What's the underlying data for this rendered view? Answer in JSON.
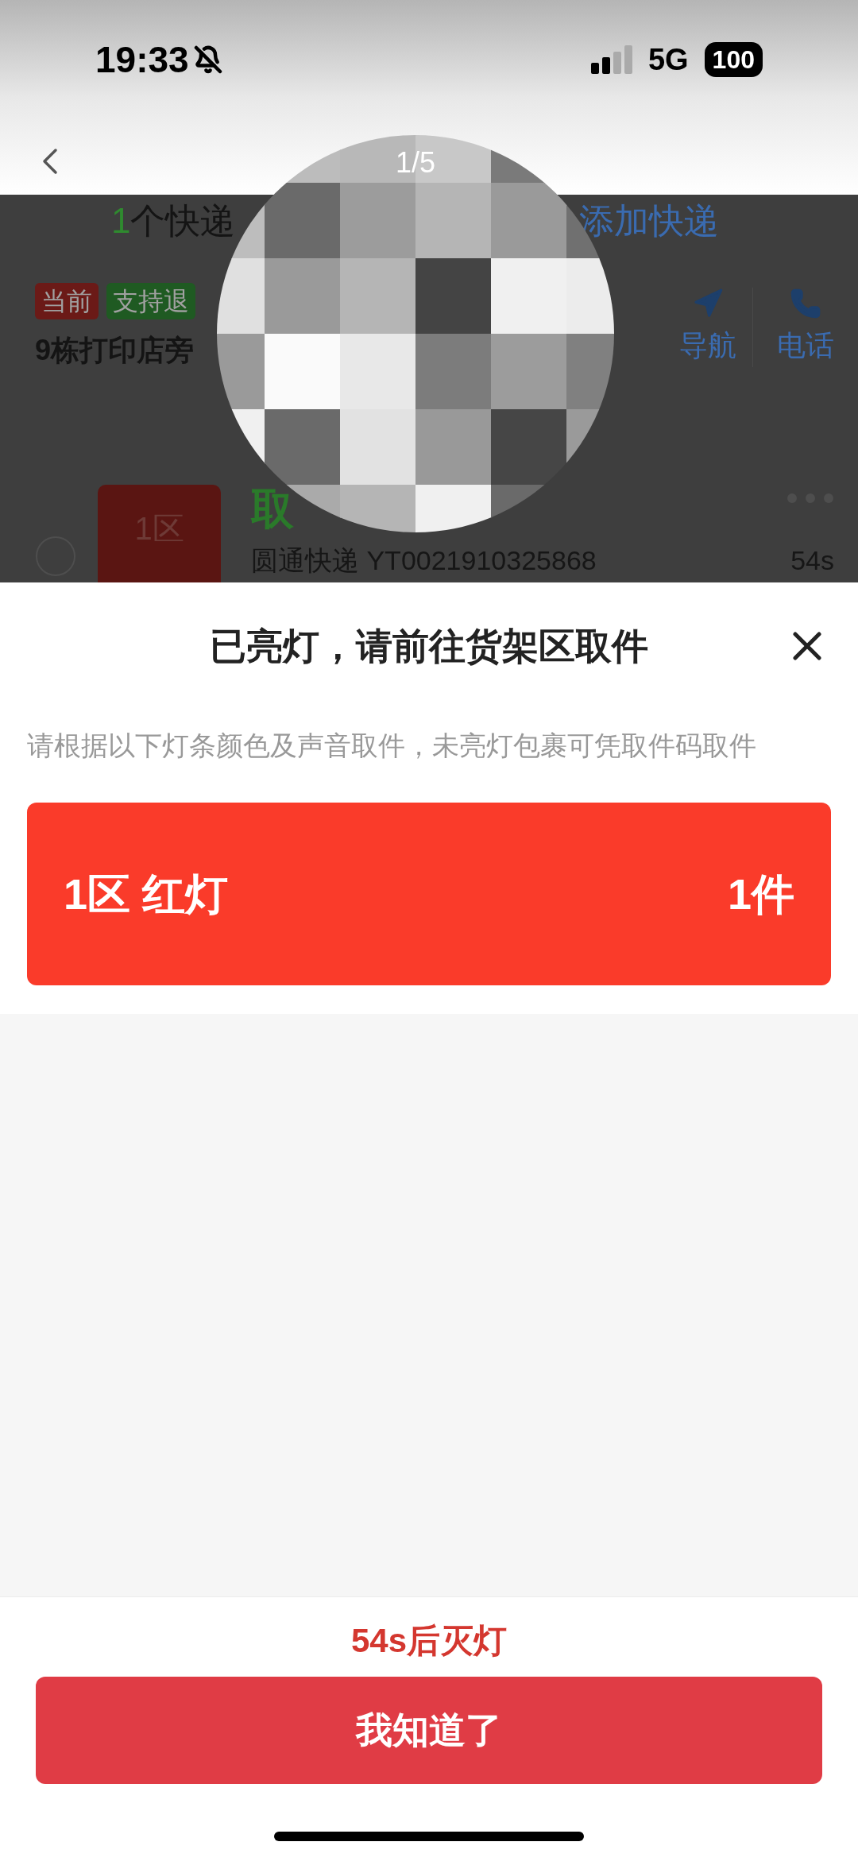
{
  "status_bar": {
    "time": "19:33",
    "network": "5G",
    "battery": "100"
  },
  "viewer": {
    "page_counter": "1/5"
  },
  "background_page": {
    "summary_count": "1",
    "summary_text": "个快递",
    "add_link": "添加快递",
    "tags": [
      {
        "label": "当前",
        "color": "#6b1a17"
      },
      {
        "label": "支持退",
        "color": "#1f5a22"
      }
    ],
    "address": "9栋打印店旁",
    "actions": [
      {
        "label": "导航",
        "kind": "navigate"
      },
      {
        "label": "电话",
        "kind": "phone"
      }
    ],
    "parcel": {
      "zone": "1区",
      "status": "取",
      "courier": "圆通快递 YT0021910325868",
      "countdown": "54s"
    }
  },
  "sheet": {
    "title": "已亮灯，请前往货架区取件",
    "description": "请根据以下灯条颜色及声音取件，未亮灯包裹可凭取件码取件",
    "lights": [
      {
        "zone": "1区 红灯",
        "count": "1件",
        "color": "#fa3b2a"
      }
    ],
    "countdown": "54s后灭灯",
    "confirm_button": "我知道了"
  }
}
